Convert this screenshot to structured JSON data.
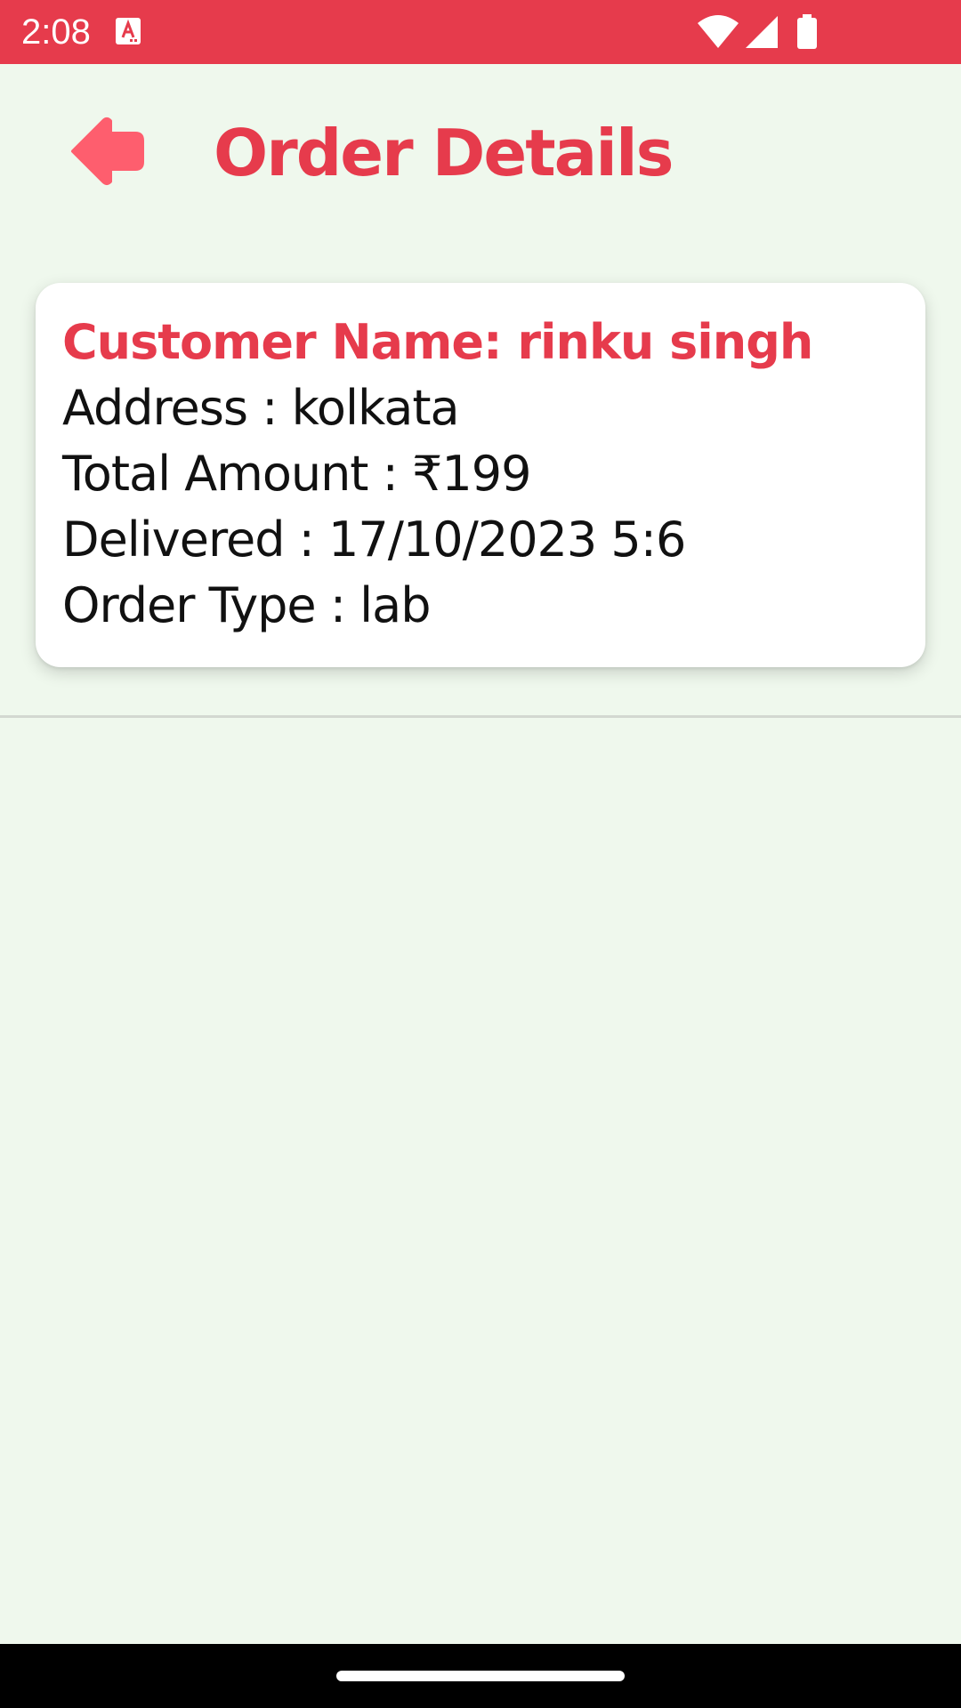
{
  "status_bar": {
    "time": "2:08",
    "icons": [
      "notification-a-icon",
      "wifi-icon",
      "signal-icon",
      "battery-icon"
    ]
  },
  "header": {
    "back_icon": "arrow-left-icon",
    "title": "Order Details"
  },
  "order": {
    "customer_line": "Customer Name: rinku singh",
    "address_line": "Address : kolkata",
    "total_line": "Total Amount : ₹199",
    "delivered_line": "Delivered : 17/10/2023 5:6",
    "order_type_line": "Order Type : lab"
  },
  "colors": {
    "accent": "#e63b4c",
    "back_arrow": "#fe5e6e",
    "background": "#eff8ed",
    "card": "#ffffff"
  }
}
